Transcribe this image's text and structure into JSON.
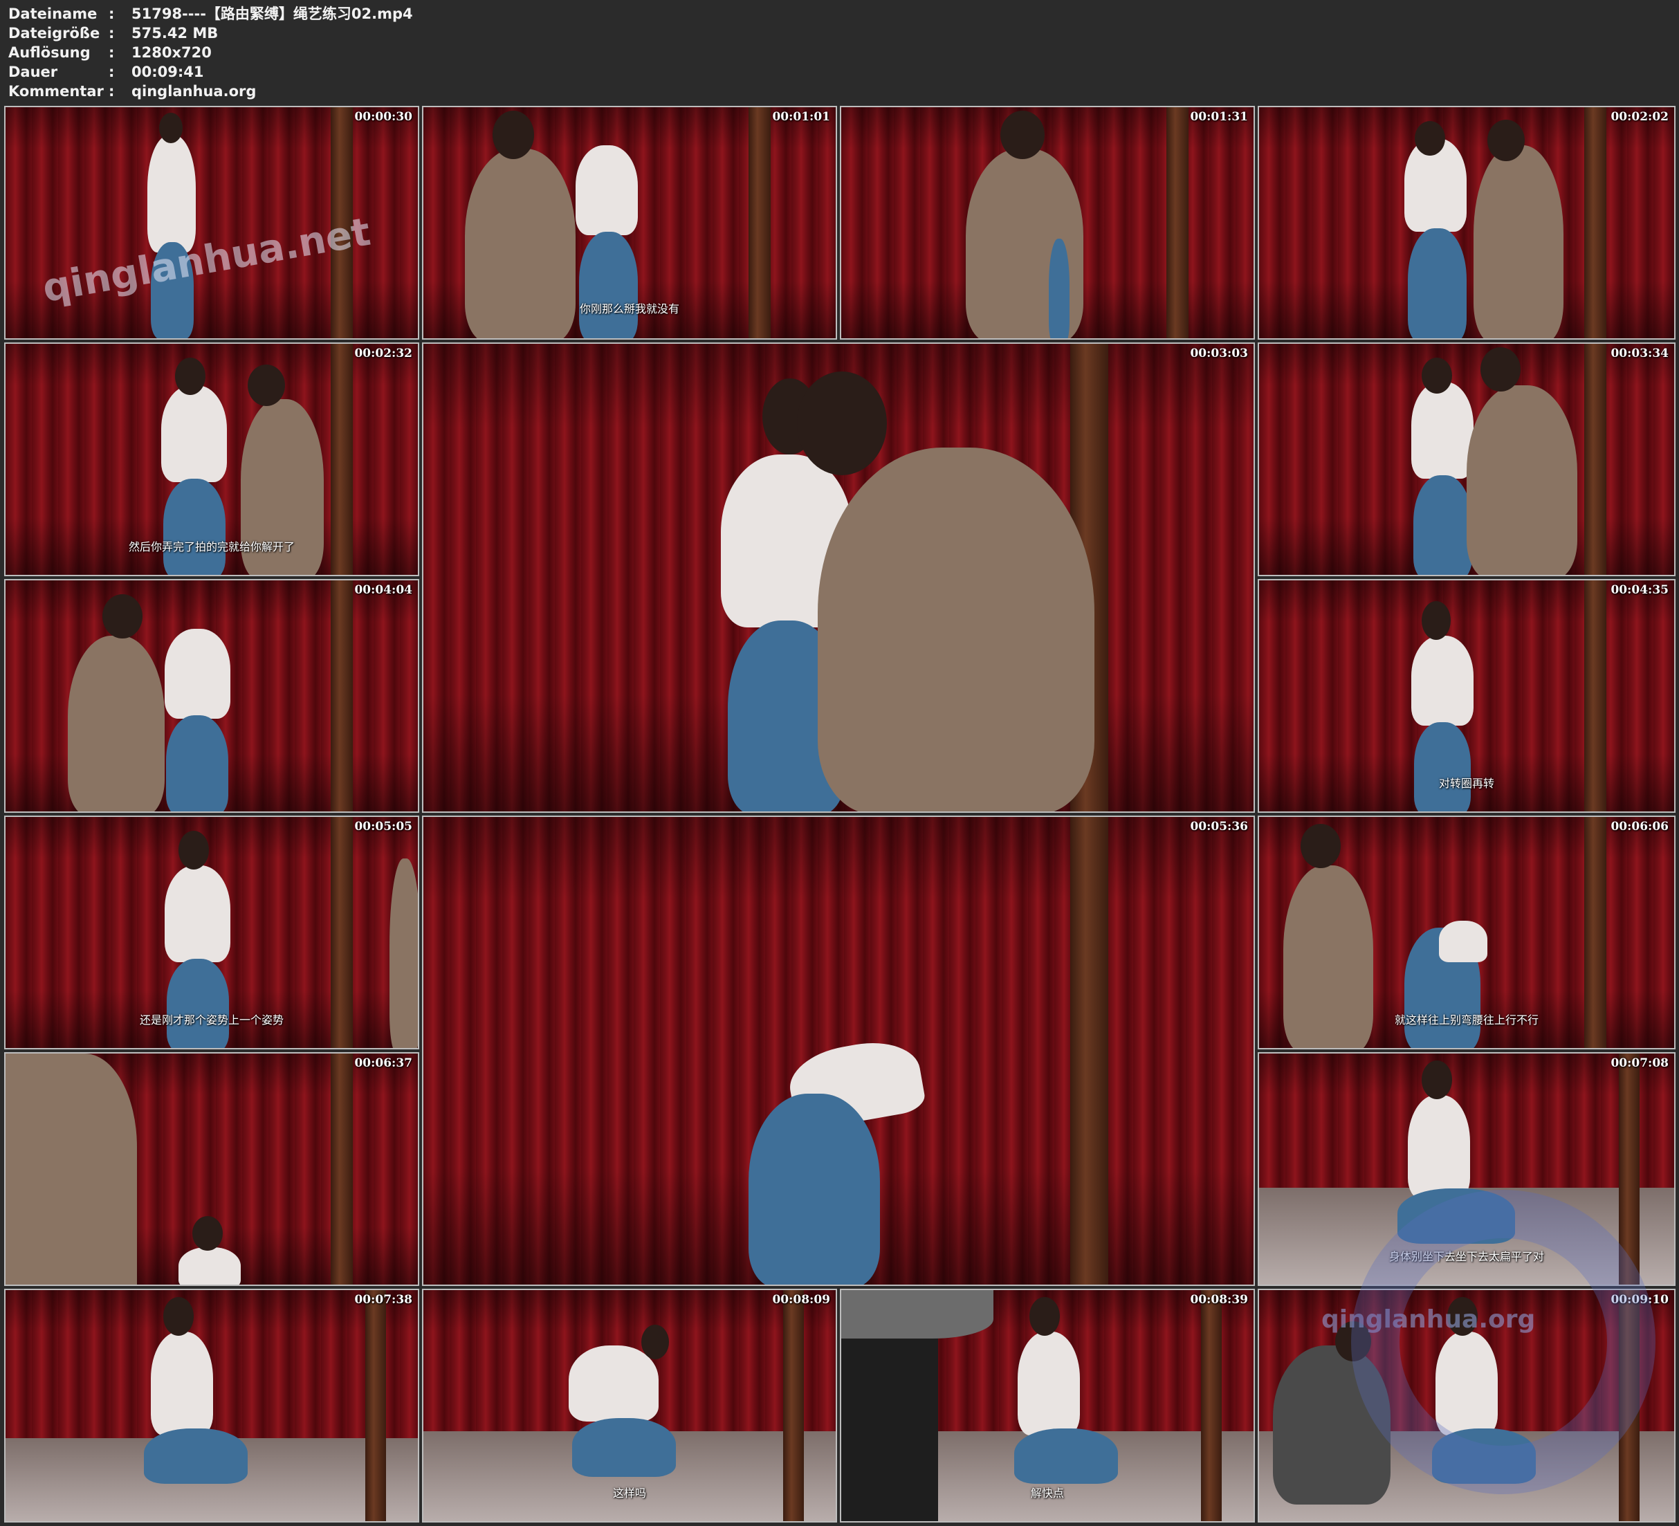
{
  "info": {
    "rows": [
      {
        "key": "Dateiname",
        "sep": ":",
        "value": "51798----【路由緊缚】绳艺练习02.mp4"
      },
      {
        "key": "Dateigröße",
        "sep": ":",
        "value": "575.42 MB"
      },
      {
        "key": "Auflösung",
        "sep": ":",
        "value": "1280x720"
      },
      {
        "key": "Dauer",
        "sep": ":",
        "value": "00:09:41"
      },
      {
        "key": "Kommentar",
        "sep": ":",
        "value": "qinglanhua.org"
      }
    ]
  },
  "thumbs": [
    {
      "time": "00:00:30",
      "subtitle": "",
      "watermark": "qinglanhua.net"
    },
    {
      "time": "00:01:01",
      "subtitle": "你刚那么掰我就没有"
    },
    {
      "time": "00:01:31",
      "subtitle": ""
    },
    {
      "time": "00:02:02",
      "subtitle": ""
    },
    {
      "time": "00:02:32",
      "subtitle": "然后你弄完了拍的完就给你解开了"
    },
    {
      "time": "00:03:03",
      "subtitle": ""
    },
    {
      "time": "00:03:34",
      "subtitle": ""
    },
    {
      "time": "00:04:04",
      "subtitle": ""
    },
    {
      "time": "00:04:35",
      "subtitle": "对转圈再转"
    },
    {
      "time": "00:05:05",
      "subtitle": "还是刚才那个姿势上一个姿势"
    },
    {
      "time": "00:05:36",
      "subtitle": ""
    },
    {
      "time": "00:06:06",
      "subtitle": "就这样往上别弯腰往上行不行"
    },
    {
      "time": "00:06:37",
      "subtitle": ""
    },
    {
      "time": "00:07:08",
      "subtitle": "身体别坐下去坐下去太扁平了对"
    },
    {
      "time": "00:07:38",
      "subtitle": ""
    },
    {
      "time": "00:08:09",
      "subtitle": "这样吗"
    },
    {
      "time": "00:08:39",
      "subtitle": "解快点"
    },
    {
      "time": "00:09:10",
      "subtitle": "",
      "watermark": "qinglanhua.org"
    }
  ]
}
